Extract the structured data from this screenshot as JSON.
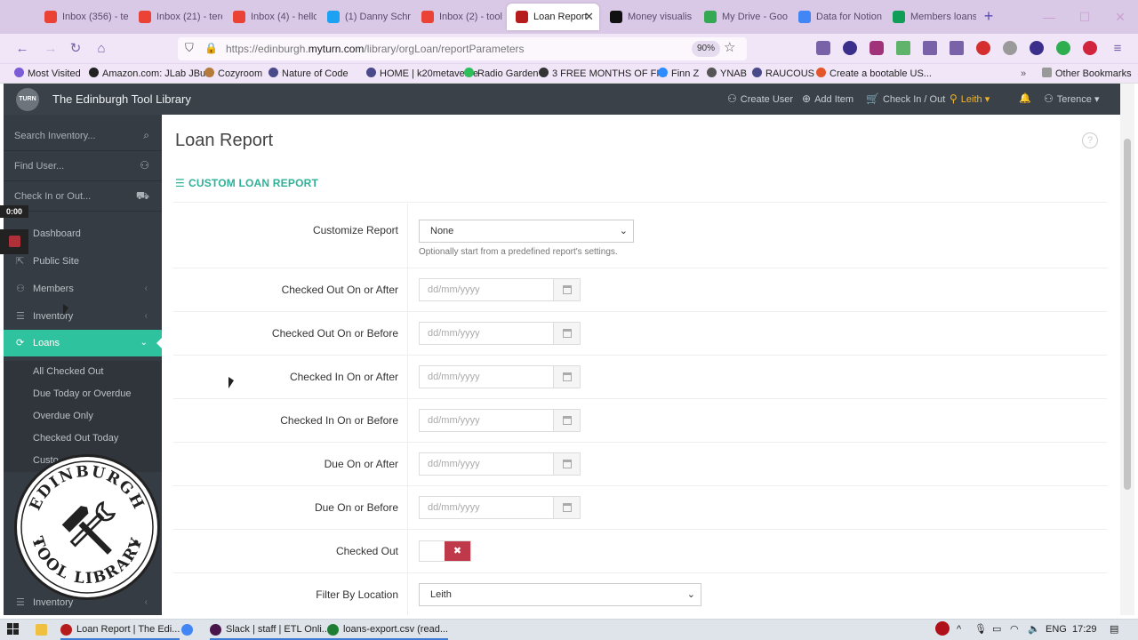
{
  "browser": {
    "tabs": [
      {
        "title": "Inbox (356) - te",
        "color": "#ea4335"
      },
      {
        "title": "Inbox (21) - tere",
        "color": "#ea4335"
      },
      {
        "title": "Inbox (4) - hello",
        "color": "#ea4335"
      },
      {
        "title": "(1) Danny Schni",
        "color": "#1da1f2"
      },
      {
        "title": "Inbox (2) - tool",
        "color": "#ea4335"
      },
      {
        "title": "Loan Report",
        "color": "#b71c1c",
        "active": true
      },
      {
        "title": "Money visualis",
        "color": "#111111"
      },
      {
        "title": "My Drive - Goo",
        "color": "#34a853"
      },
      {
        "title": "Data for Notion",
        "color": "#4285f4"
      },
      {
        "title": "Members loans",
        "color": "#0f9d58"
      }
    ],
    "new_tab": "+",
    "url_prefix": "https://edinburgh.",
    "url_domain": "myturn.com",
    "url_path": "/library/orgLoan/reportParameters",
    "zoom": "90%",
    "bookmarks": [
      {
        "label": "Most Visited",
        "color": "#7b5bd6"
      },
      {
        "label": "Amazon.com: JLab JBu...",
        "color": "#222222"
      },
      {
        "label": "Cozyroom",
        "color": "#b57b3a"
      },
      {
        "label": "Nature of Code",
        "color": "#4a4a8a"
      },
      {
        "label": "HOME | k20metaverse",
        "color": "#4a4a8a"
      },
      {
        "label": "Radio Garden",
        "color": "#2fbf5a"
      },
      {
        "label": "3 FREE MONTHS OF FI...",
        "color": "#333333"
      },
      {
        "label": "Finn Z",
        "color": "#2d8cff"
      },
      {
        "label": "YNAB",
        "color": "#555555"
      },
      {
        "label": "RAUCOUS",
        "color": "#4a4a8a"
      },
      {
        "label": "Create a bootable US...",
        "color": "#e2562a"
      }
    ],
    "other_bookmarks": "Other Bookmarks"
  },
  "app": {
    "title": "The Edinburgh Tool Library",
    "logo_text": "TURN",
    "header_links": {
      "create_user": "Create User",
      "add_item": "Add Item",
      "check_in_out": "Check In / Out",
      "location": "Leith",
      "user": "Terence"
    },
    "accent": "#2fc29e"
  },
  "sidebar": {
    "search_inventory": "Search Inventory...",
    "find_user": "Find User...",
    "check_in_out": "Check In or Out...",
    "timer": "0:00",
    "items": {
      "dashboard": "Dashboard",
      "public_site": "Public Site",
      "members": "Members",
      "inventory": "Inventory",
      "loans": "Loans"
    },
    "loans_sub": {
      "all_checked_out": "All Checked Out",
      "due_today": "Due Today or Overdue",
      "overdue": "Overdue Only",
      "checked_out_today": "Checked Out Today",
      "custom": "Custo..."
    },
    "bottom_item": "Inventory"
  },
  "seal": {
    "text_top": "EDINBURGH",
    "text_bottom": "TOOL LIBRARY"
  },
  "main": {
    "page_title": "Loan Report",
    "section_title": "CUSTOM LOAN REPORT",
    "customize_label": "Customize Report",
    "customize_value": "None",
    "customize_hint": "Optionally start from a predefined report's settings.",
    "date_placeholder": "dd/mm/yyyy",
    "fields": {
      "checked_out_after": "Checked Out On or After",
      "checked_out_before": "Checked Out On or Before",
      "checked_in_after": "Checked In On or After",
      "checked_in_before": "Checked In On or Before",
      "due_after": "Due On or After",
      "due_before": "Due On or Before",
      "checked_out": "Checked Out",
      "filter_location": "Filter By Location"
    },
    "checked_out_toggle": "✖",
    "location_value": "Leith"
  },
  "taskbar": {
    "items": [
      {
        "label": "Loan Report | The Edi...",
        "color": "#b71c1c"
      },
      {
        "label": "",
        "color": "#4285f4"
      },
      {
        "label": "Slack | staff | ETL Onli...",
        "color": "#4a154b"
      },
      {
        "label": "loans-export.csv (read...",
        "color": "#1e7e34"
      }
    ],
    "lang": "ENG",
    "time": "17:29"
  }
}
